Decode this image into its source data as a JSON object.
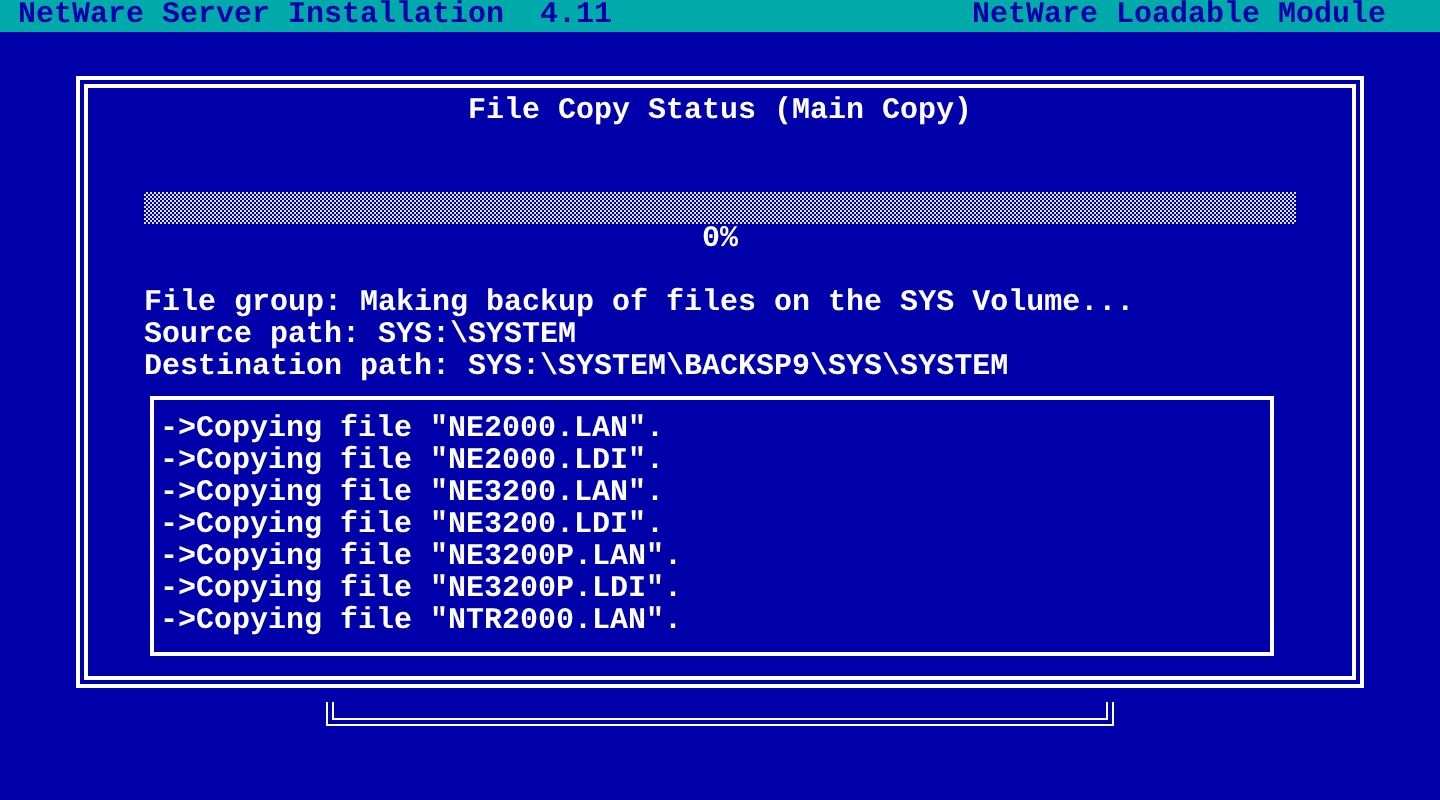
{
  "header": {
    "title": "NetWare Server Installation  4.11",
    "module": "NetWare Loadable Module"
  },
  "dialog": {
    "title": "File Copy Status (Main Copy)",
    "progress": {
      "level": 0,
      "reading": "0%"
    },
    "info": [
      "File group: Making backup of files on the SYS Volume...",
      "Source path: SYS:\\SYSTEM",
      "Destination path: SYS:\\SYSTEM\\BACKSP9\\SYS\\SYSTEM"
    ],
    "log": [
      "->Copying file \"NE2000.LAN\".",
      "->Copying file \"NE2000.LDI\".",
      "->Copying file \"NE3200.LAN\".",
      "->Copying file \"NE3200.LDI\".",
      "->Copying file \"NE3200P.LAN\".",
      "->Copying file \"NE3200P.LDI\".",
      "->Copying file \"NTR2000.LAN\"."
    ]
  }
}
